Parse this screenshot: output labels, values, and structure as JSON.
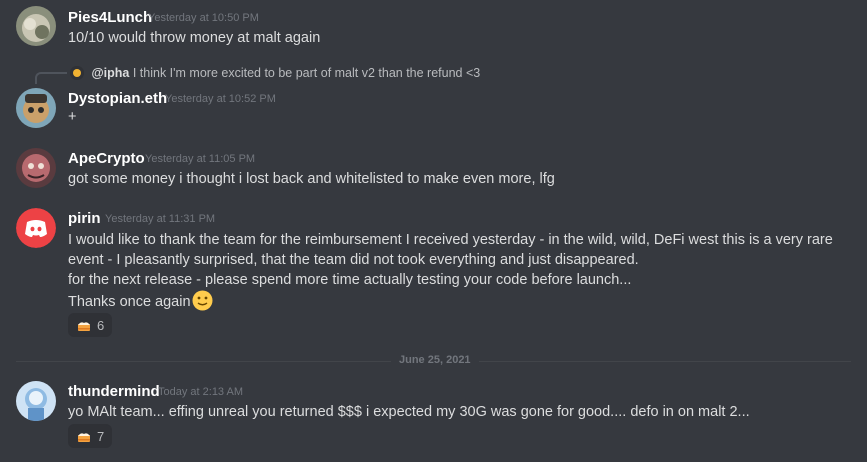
{
  "messages": [
    {
      "username": "Pies4Lunch",
      "timestamp": "Yesterday at 10:50 PM",
      "lines": [
        "10/10 would throw money at malt again"
      ]
    },
    {
      "reply": {
        "mention": "@ipha",
        "text": "I think I'm more excited to be part of malt v2 than the refund <3"
      },
      "username": "Dystopian.eth",
      "timestamp": "Yesterday at 10:52 PM",
      "lines": [
        "+"
      ]
    },
    {
      "username": "ApeCrypto",
      "timestamp": "Yesterday at 11:05 PM",
      "lines": [
        "got some money i thought i lost back and whitelisted to make even more, lfg"
      ]
    },
    {
      "username": "pirin",
      "timestamp": "Yesterday at 11:31 PM",
      "lines": [
        "I would like to thank the team for the reimbursement I received yesterday - in the wild, wild, DeFi west this is a very rare",
        "event - I pleasantly surprised, that the team did not took everything and just disappeared.",
        "for the next release - please spend more time actually testing your code before launch...",
        "Thanks once again"
      ],
      "reaction": {
        "icon": "cake-emoji-icon",
        "count": "6"
      }
    },
    {
      "username": "thundermind",
      "timestamp": "Today at 2:13 AM",
      "lines": [
        "yo MAlt team... effing unreal you returned $$$ i expected my 30G was gone for good.... defo in on malt 2..."
      ],
      "reaction": {
        "icon": "cake-emoji-icon",
        "count": "7"
      }
    }
  ],
  "date_divider": "June 25, 2021",
  "colors": {
    "background": "#36393f",
    "username": "#ffffff",
    "text": "#dcddde",
    "timestamp": "#72767d",
    "discord_blurple": "#ed4245"
  }
}
